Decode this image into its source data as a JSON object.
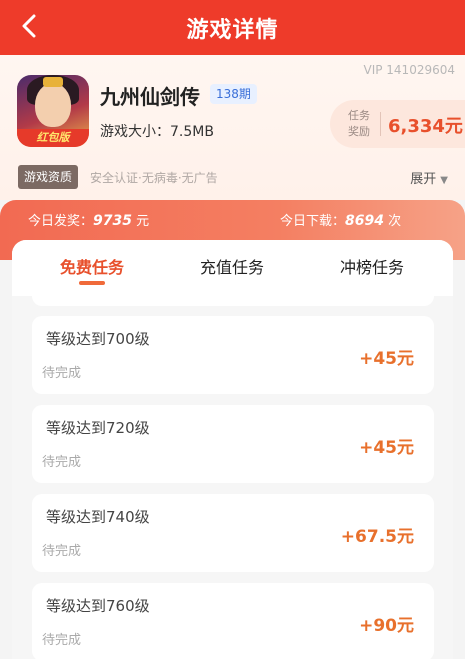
{
  "header": {
    "title": "游戏详情",
    "back_icon": "chevron-left-icon"
  },
  "game": {
    "vip_id": "VIP 141029604",
    "icon_badge": "红包版",
    "name": "九州仙剑传",
    "period": "138期",
    "size": "游戏大小：7.5MB",
    "reward_label": "任务奖励",
    "reward_value": "6,334元"
  },
  "qualification": {
    "tag": "游戏资质",
    "text": "安全认证·无病毒·无广告",
    "expand_label": "展开"
  },
  "stats": {
    "today_reward_label": "今日发奖：",
    "today_reward_value": "9735",
    "today_reward_unit": "元",
    "today_download_label": "今日下载：",
    "today_download_value": "8694",
    "today_download_unit": "次"
  },
  "tabs": [
    {
      "label": "免费任务",
      "active": true
    },
    {
      "label": "充值任务",
      "active": false
    },
    {
      "label": "冲榜任务",
      "active": false
    }
  ],
  "tasks": [
    {
      "name": "等级达到700级",
      "status": "待完成",
      "reward": "+45元"
    },
    {
      "name": "等级达到720级",
      "status": "待完成",
      "reward": "+45元"
    },
    {
      "name": "等级达到740级",
      "status": "待完成",
      "reward": "+67.5元"
    },
    {
      "name": "等级达到760级",
      "status": "待完成",
      "reward": "+90元"
    }
  ],
  "colors": {
    "brand_red": "#ee3b2a",
    "accent_orange": "#e8502c"
  }
}
